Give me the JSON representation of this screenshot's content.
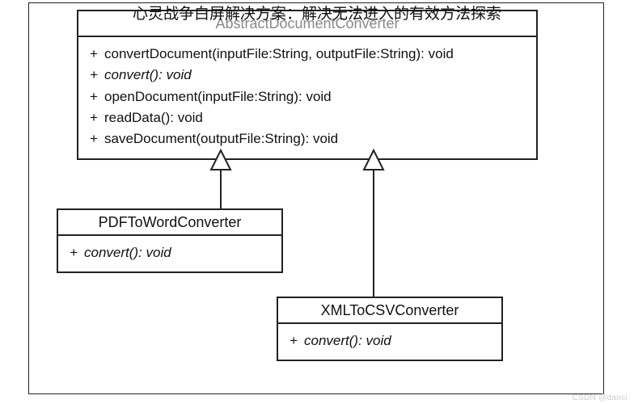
{
  "overlay_title": "心灵战争白屏解决方案：解决无法进入的有效方法探索",
  "abstract": {
    "name": "AbstractDocumentConverter",
    "members": [
      {
        "sig": "convertDocument(inputFile:String, outputFile:String): void",
        "italic": false
      },
      {
        "sig": "convert(): void",
        "italic": true
      },
      {
        "sig": "openDocument(inputFile:String): void",
        "italic": false
      },
      {
        "sig": "readData(): void",
        "italic": false
      },
      {
        "sig": "saveDocument(outputFile:String): void",
        "italic": false
      }
    ]
  },
  "pdf": {
    "name": "PDFToWordConverter",
    "members": [
      {
        "sig": "convert(): void",
        "italic": true
      }
    ]
  },
  "xml": {
    "name": "XMLToCSVConverter",
    "members": [
      {
        "sig": "convert(): void",
        "italic": true
      }
    ]
  },
  "bullet": "+",
  "watermark": "CSDN @danci"
}
